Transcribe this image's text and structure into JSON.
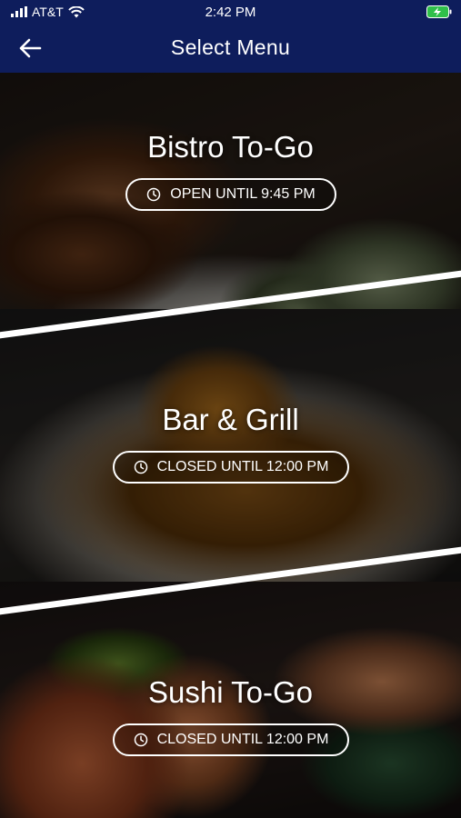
{
  "status_bar": {
    "carrier": "AT&T",
    "time": "2:42 PM",
    "wifi_icon": "wifi-icon",
    "battery_icon": "battery-charging-icon"
  },
  "header": {
    "title": "Select Menu",
    "back_icon": "arrow-left-icon",
    "background": "#0e1d5c"
  },
  "menus": [
    {
      "name": "Bistro To-Go",
      "status": "OPEN UNTIL 9:45 PM",
      "status_icon": "clock-icon"
    },
    {
      "name": "Bar & Grill",
      "status": "CLOSED UNTIL 12:00 PM",
      "status_icon": "clock-icon"
    },
    {
      "name": "Sushi To-Go",
      "status": "CLOSED UNTIL 12:00 PM",
      "status_icon": "clock-icon"
    }
  ]
}
